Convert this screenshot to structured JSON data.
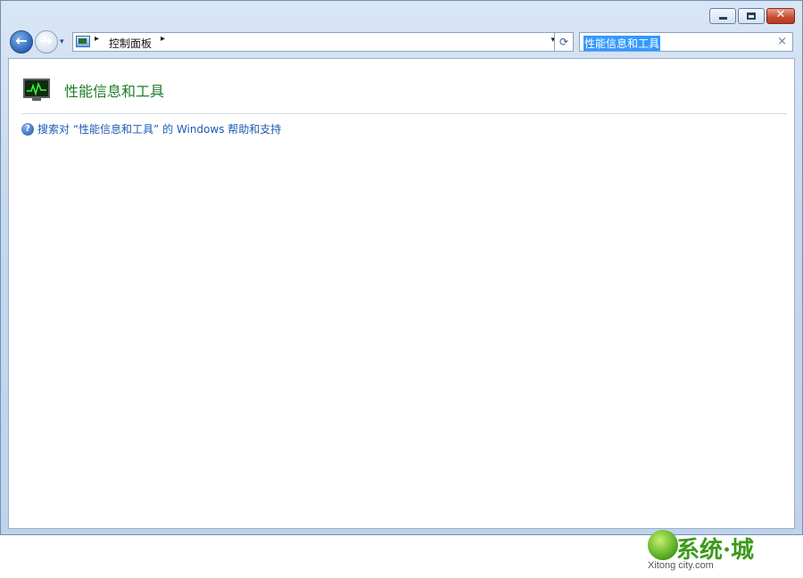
{
  "window": {
    "caption": {
      "minimize_icon": "minimize-icon",
      "maximize_icon": "maximize-icon",
      "close_symbol": "✕"
    }
  },
  "navigation": {
    "back_icon": "back-arrow-icon",
    "forward_icon": "forward-arrow-icon",
    "recent_icon": "chevron-down-icon",
    "back_glyph": "←",
    "forward_glyph": "→",
    "recent_glyph": "▾"
  },
  "address": {
    "icon": "control-panel-icon",
    "breadcrumb": [
      "控制面板"
    ],
    "arrow": "▸",
    "dropdown_glyph": "▾",
    "refresh_glyph": "⟳"
  },
  "search": {
    "value": "性能信息和工具",
    "clear_glyph": "×"
  },
  "content": {
    "title": "性能信息和工具",
    "help_glyph": "?",
    "help_link": "搜索对 “性能信息和工具” 的 Windows 帮助和支持"
  },
  "watermark": {
    "main": "系统·城",
    "sub": "Xitong city.com"
  },
  "colors": {
    "accent_green": "#1e7d2a",
    "link_blue": "#1c5ab5",
    "selection_blue": "#3399ff",
    "close_red": "#c34b2e"
  }
}
